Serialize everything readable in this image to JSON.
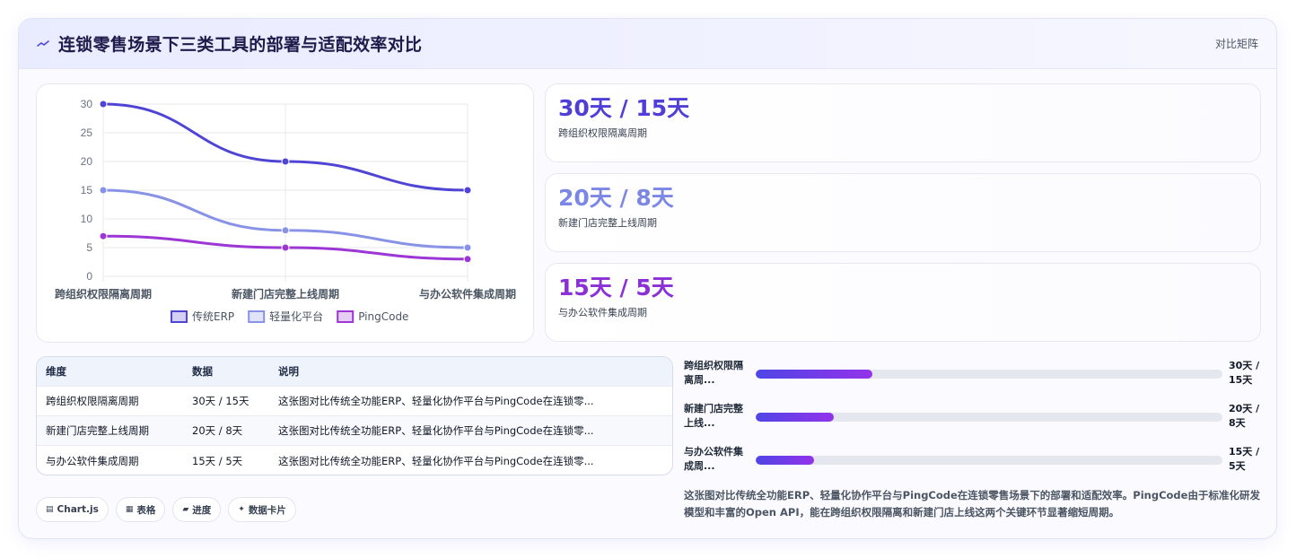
{
  "header": {
    "title": "连锁零售场景下三类工具的部署与适配效率对比",
    "right_label": "对比矩阵",
    "icon": "trend-line-icon"
  },
  "colors": {
    "erp": "#5044d4",
    "light": "#8892e6",
    "pingcode": "#9c36d4",
    "accent": "#4f46e5"
  },
  "chart_data": {
    "type": "line",
    "categories": [
      "跨组织权限隔离周期",
      "新建门店完整上线周期",
      "与办公软件集成周期"
    ],
    "series": [
      {
        "name": "传统ERP",
        "values": [
          30,
          20,
          15
        ]
      },
      {
        "name": "轻量化平台",
        "values": [
          15,
          8,
          5
        ]
      },
      {
        "name": "PingCode",
        "values": [
          7,
          5,
          3
        ]
      }
    ],
    "ylim": [
      0,
      30
    ],
    "yticks": [
      "0",
      "5",
      "10",
      "15",
      "20",
      "25",
      "30"
    ],
    "grid": true,
    "legend": "bottom"
  },
  "stats": [
    {
      "value": "30天 / 15天",
      "label": "跨组织权限隔离周期",
      "color": "#4f3fd6"
    },
    {
      "value": "20天 / 8天",
      "label": "新建门店完整上线周期",
      "color": "#7b87e4"
    },
    {
      "value": "15天 / 5天",
      "label": "与办公软件集成周期",
      "color": "#8b2fd6"
    }
  ],
  "table": {
    "headers": [
      "维度",
      "数据",
      "说明"
    ],
    "rows": [
      [
        "跨组织权限隔离周期",
        "30天 / 15天",
        "这张图对比传统全功能ERP、轻量化协作平台与PingCode在连锁零..."
      ],
      [
        "新建门店完整上线周期",
        "20天 / 8天",
        "这张图对比传统全功能ERP、轻量化协作平台与PingCode在连锁零..."
      ],
      [
        "与办公软件集成周期",
        "15天 / 5天",
        "这张图对比传统全功能ERP、轻量化协作平台与PingCode在连锁零..."
      ]
    ]
  },
  "tags": [
    {
      "icon": "▤",
      "label": "Chart.js"
    },
    {
      "icon": "▦",
      "label": "表格"
    },
    {
      "icon": "▰",
      "label": "进度"
    },
    {
      "icon": "✦",
      "label": "数据卡片"
    }
  ],
  "progress": [
    {
      "label": "跨组织权限隔离周...",
      "value": "30天 / 15天",
      "fraction": 0.25
    },
    {
      "label": "新建门店完整上线...",
      "value": "20天 / 8天",
      "fraction": 0.167
    },
    {
      "label": "与办公软件集成周...",
      "value": "15天 / 5天",
      "fraction": 0.125
    }
  ],
  "summary": "这张图对比传统全功能ERP、轻量化协作平台与PingCode在连锁零售场景下的部署和适配效率。PingCode由于标准化研发模型和丰富的Open API，能在跨组织权限隔离和新建门店上线这两个关键环节显著缩短周期。"
}
